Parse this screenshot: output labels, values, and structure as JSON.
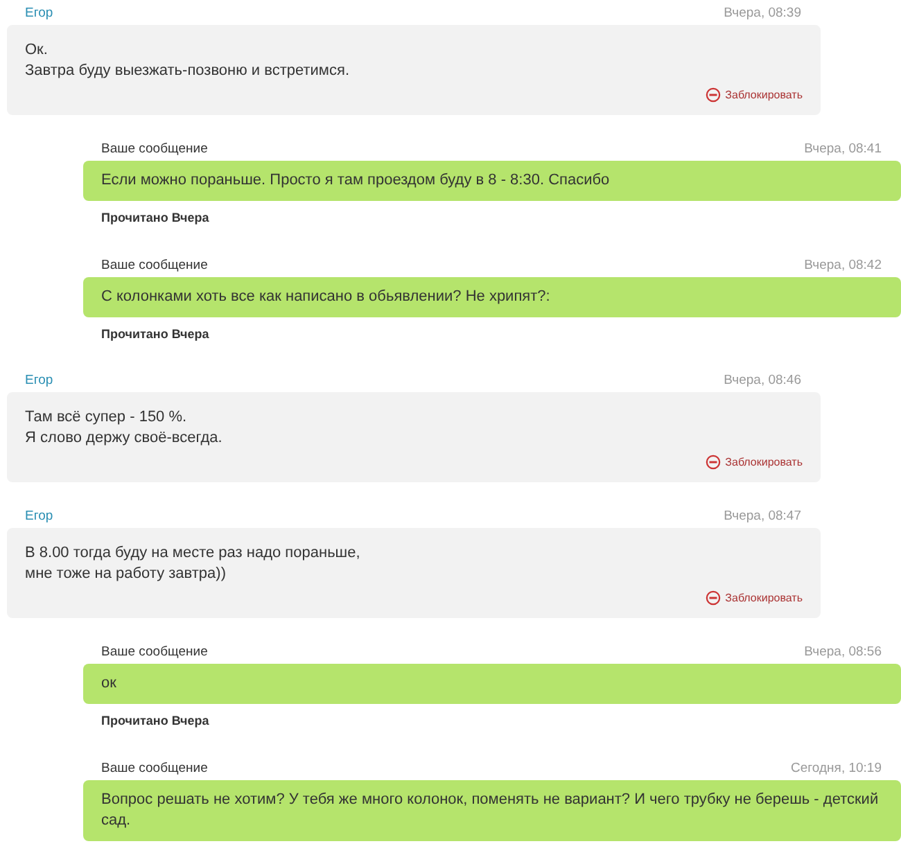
{
  "messages": [
    {
      "kind": "incoming",
      "sender": "Егор",
      "time": "Вчера, 08:39",
      "text": "Ок.\nЗавтра буду выезжать-позвоню и встретимся.",
      "action": "Заблокировать"
    },
    {
      "kind": "outgoing",
      "sender": "Ваше сообщение",
      "time": "Вчера, 08:41",
      "text": "Если можно пораньше. Просто я там проездом буду в 8 - 8:30. Спасибо",
      "status": "Прочитано Вчера"
    },
    {
      "kind": "outgoing",
      "sender": "Ваше сообщение",
      "time": "Вчера, 08:42",
      "text": "С колонками хоть все как написано в обьявлении? Не хрипят?:",
      "status": "Прочитано Вчера"
    },
    {
      "kind": "incoming",
      "sender": "Егор",
      "time": "Вчера, 08:46",
      "text": "Там всё супер - 150 %.\nЯ слово держу своё-всегда.",
      "action": "Заблокировать"
    },
    {
      "kind": "incoming",
      "sender": "Егор",
      "time": "Вчера, 08:47",
      "text": "В 8.00 тогда буду на месте раз надо пораньше,\nмне тоже на работу завтра))",
      "action": "Заблокировать"
    },
    {
      "kind": "outgoing",
      "sender": "Ваше сообщение",
      "time": "Вчера, 08:56",
      "text": "ок",
      "status": "Прочитано Вчера"
    },
    {
      "kind": "outgoing",
      "sender": "Ваше сообщение",
      "time": "Сегодня, 10:19",
      "text": "Вопрос решать не хотим? У тебя же много колонок, поменять не вариант? И чего трубку не берешь - детский сад."
    }
  ]
}
